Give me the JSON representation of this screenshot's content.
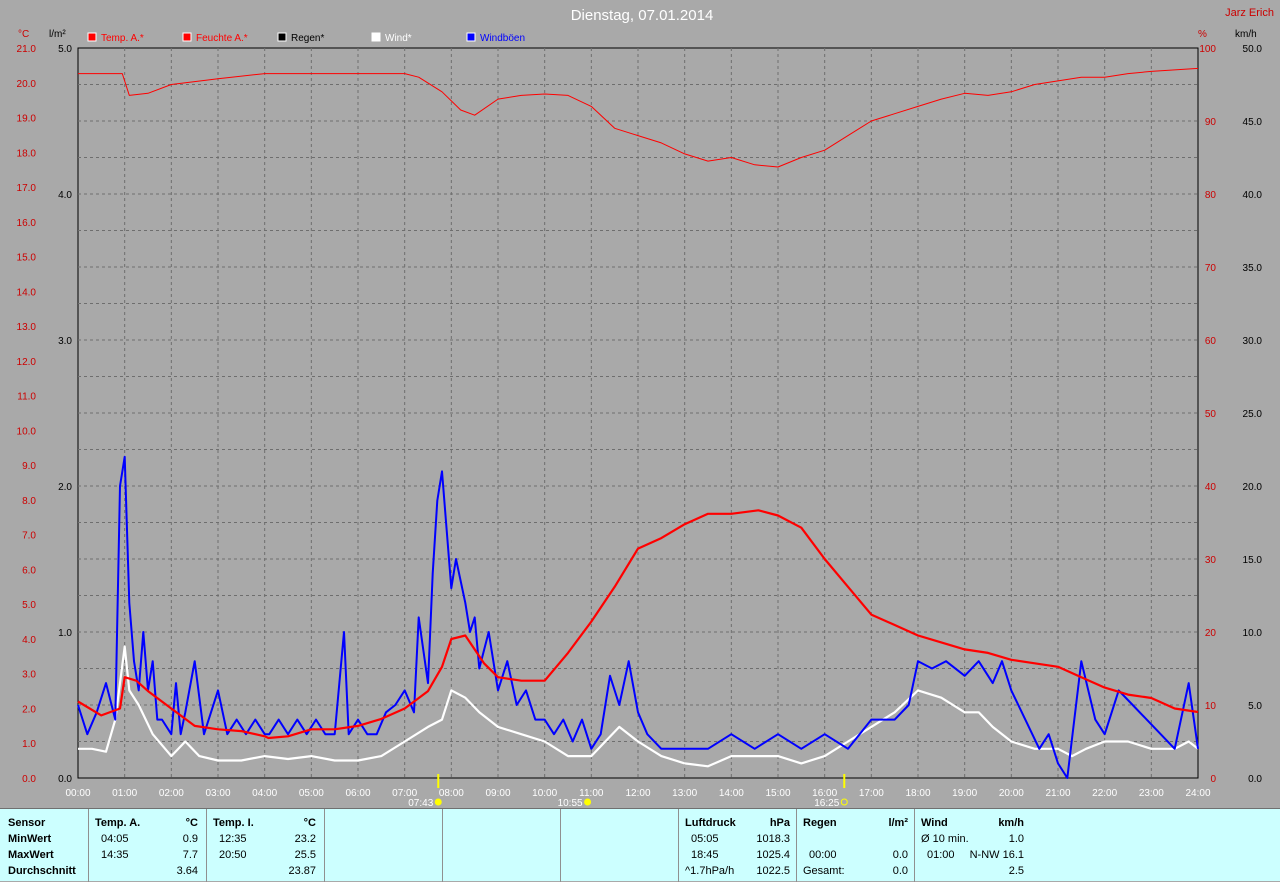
{
  "header": {
    "date": "Dienstag, 07.01.2014",
    "author": "Jarz Erich",
    "unit_temp": "°C",
    "unit_rain": "l/m²",
    "unit_pct": "%",
    "unit_wind": "km/h"
  },
  "colors": {
    "background": "#a9a9a9",
    "temp": "#ff0000",
    "humidity": "#ff0000",
    "rain": "#000000",
    "wind": "#ffffff",
    "gusts": "#0000ff",
    "axis_red": "#cc0000",
    "panel": "#ccffff",
    "sun_marker": "#ffff00"
  },
  "legend": [
    {
      "label": "Temp. A.*",
      "color": "#ff0000"
    },
    {
      "label": "Feuchte A.*",
      "color": "#ff0000"
    },
    {
      "label": "Regen*",
      "color": "#000000"
    },
    {
      "label": "Wind*",
      "color": "#ffffff"
    },
    {
      "label": "Windböen",
      "color": "#0000ff"
    }
  ],
  "chart_data": {
    "type": "line",
    "title": "Dienstag, 07.01.2014",
    "x_range_hours": [
      0,
      24
    ],
    "x_ticks": [
      "00:00",
      "01:00",
      "02:00",
      "03:00",
      "04:00",
      "05:00",
      "06:00",
      "07:00",
      "08:00",
      "09:00",
      "10:00",
      "11:00",
      "12:00",
      "13:00",
      "14:00",
      "15:00",
      "16:00",
      "17:00",
      "18:00",
      "19:00",
      "20:00",
      "21:00",
      "22:00",
      "23:00",
      "24:00"
    ],
    "axes": {
      "temp": {
        "range": [
          0,
          21
        ],
        "ticks": [
          "0.0",
          "1.0",
          "2.0",
          "3.0",
          "4.0",
          "5.0",
          "6.0",
          "7.0",
          "8.0",
          "9.0",
          "10.0",
          "11.0",
          "12.0",
          "13.0",
          "14.0",
          "15.0",
          "16.0",
          "17.0",
          "18.0",
          "19.0",
          "20.0",
          "21.0"
        ]
      },
      "rain": {
        "range": [
          0,
          5
        ],
        "ticks": [
          "0.0",
          "1.0",
          "2.0",
          "3.0",
          "4.0",
          "5.0"
        ]
      },
      "humidity": {
        "range": [
          0,
          100
        ],
        "ticks": [
          "0",
          "10",
          "20",
          "30",
          "40",
          "50",
          "60",
          "70",
          "80",
          "90",
          "100"
        ]
      },
      "wind": {
        "range": [
          0,
          50
        ],
        "ticks": [
          "0.0",
          "5.0",
          "10.0",
          "15.0",
          "20.0",
          "25.0",
          "30.0",
          "35.0",
          "40.0",
          "45.0",
          "50.0"
        ]
      }
    },
    "grid": true,
    "markers": [
      {
        "label": "07:43",
        "hour": 7.72,
        "kind": "sunrise"
      },
      {
        "label": "10:55",
        "hour": 10.92,
        "kind": "noon"
      },
      {
        "label": "16:25",
        "hour": 16.42,
        "kind": "sunset"
      }
    ],
    "series": [
      {
        "name": "Temp. A.*",
        "axis": "temp",
        "x": [
          0,
          0.5,
          0.9,
          1.0,
          1.25,
          1.5,
          2.0,
          2.5,
          3.0,
          3.5,
          4.0,
          4.08,
          4.5,
          5.0,
          5.5,
          6.0,
          6.5,
          7.0,
          7.5,
          7.8,
          8.0,
          8.3,
          8.7,
          9.0,
          9.5,
          10.0,
          10.5,
          11.0,
          11.5,
          12.0,
          12.5,
          13.0,
          13.5,
          14.0,
          14.58,
          15.0,
          15.5,
          16.0,
          16.5,
          17.0,
          17.5,
          18.0,
          18.5,
          19.0,
          19.5,
          20.0,
          20.5,
          21.0,
          21.5,
          22.0,
          22.5,
          23.0,
          23.5,
          24.0
        ],
        "y": [
          2.2,
          1.8,
          2.0,
          2.9,
          2.8,
          2.5,
          2.0,
          1.5,
          1.4,
          1.35,
          1.2,
          1.15,
          1.2,
          1.4,
          1.4,
          1.5,
          1.7,
          2.0,
          2.5,
          3.2,
          4.0,
          4.1,
          3.3,
          2.9,
          2.8,
          2.8,
          3.6,
          4.5,
          5.5,
          6.6,
          6.9,
          7.3,
          7.6,
          7.6,
          7.7,
          7.55,
          7.2,
          6.3,
          5.5,
          4.7,
          4.4,
          4.1,
          3.9,
          3.7,
          3.6,
          3.4,
          3.3,
          3.2,
          2.9,
          2.6,
          2.4,
          2.3,
          2.0,
          1.9
        ]
      },
      {
        "name": "Feuchte A.*",
        "axis": "humidity",
        "x": [
          0,
          0.5,
          0.95,
          1.1,
          1.5,
          2.0,
          3.0,
          4.0,
          5.0,
          6.0,
          7.0,
          7.3,
          7.8,
          8.2,
          8.5,
          9.0,
          9.5,
          10.0,
          10.5,
          11.0,
          11.5,
          12.0,
          12.5,
          13.0,
          13.5,
          14.0,
          14.5,
          15.0,
          15.5,
          16.0,
          16.5,
          17.0,
          17.5,
          18.0,
          18.5,
          19.0,
          19.5,
          20.0,
          20.5,
          21.0,
          21.5,
          22.0,
          22.5,
          23.0,
          23.5,
          24.0
        ],
        "y": [
          96.5,
          96.5,
          96.5,
          93.5,
          93.8,
          95.0,
          95.8,
          96.5,
          96.5,
          96.5,
          96.5,
          96.0,
          94.0,
          91.5,
          90.8,
          93.0,
          93.5,
          93.7,
          93.5,
          92.0,
          89.0,
          88.0,
          87.0,
          85.5,
          84.5,
          85.0,
          84.0,
          83.7,
          85.0,
          86.0,
          88.0,
          90.0,
          91.0,
          92.0,
          93.0,
          93.8,
          93.5,
          94.0,
          95.0,
          95.5,
          96.0,
          96.0,
          96.5,
          96.8,
          97.0,
          97.2
        ]
      },
      {
        "name": "Wind*",
        "axis": "wind",
        "x": [
          0,
          0.3,
          0.6,
          0.8,
          1.0,
          1.1,
          1.3,
          1.6,
          2.0,
          2.3,
          2.6,
          3.0,
          3.5,
          4.0,
          4.5,
          5.0,
          5.5,
          6.0,
          6.5,
          7.0,
          7.5,
          7.8,
          8.0,
          8.3,
          8.6,
          9.0,
          9.5,
          10.0,
          10.5,
          11.0,
          11.3,
          11.6,
          12.0,
          12.5,
          13.0,
          13.5,
          14.0,
          14.5,
          15.0,
          15.5,
          16.0,
          16.5,
          17.0,
          17.5,
          18.0,
          18.5,
          19.0,
          19.3,
          19.6,
          20.0,
          20.5,
          21.0,
          21.3,
          21.6,
          22.0,
          22.5,
          23.0,
          23.5,
          23.8,
          24.0
        ],
        "y": [
          2.0,
          2.0,
          1.8,
          4.0,
          9.0,
          6.0,
          5.0,
          3.0,
          1.5,
          2.5,
          1.5,
          1.2,
          1.2,
          1.5,
          1.3,
          1.5,
          1.2,
          1.2,
          1.5,
          2.5,
          3.5,
          4.0,
          6.0,
          5.5,
          4.5,
          3.5,
          3.0,
          2.5,
          1.5,
          1.5,
          2.5,
          3.5,
          2.5,
          1.5,
          1.0,
          0.8,
          1.5,
          1.5,
          1.5,
          1.0,
          1.5,
          2.5,
          3.5,
          4.5,
          6.0,
          5.5,
          4.5,
          4.5,
          3.5,
          2.5,
          2.0,
          2.0,
          1.5,
          2.0,
          2.5,
          2.5,
          2.0,
          2.0,
          2.5,
          2.0
        ]
      },
      {
        "name": "Windböen",
        "axis": "wind",
        "x": [
          0,
          0.2,
          0.4,
          0.6,
          0.8,
          0.9,
          1.0,
          1.1,
          1.2,
          1.3,
          1.4,
          1.5,
          1.6,
          1.7,
          1.8,
          2.0,
          2.1,
          2.2,
          2.3,
          2.5,
          2.7,
          3.0,
          3.2,
          3.4,
          3.6,
          3.8,
          4.0,
          4.1,
          4.3,
          4.5,
          4.7,
          4.9,
          5.1,
          5.3,
          5.5,
          5.7,
          5.8,
          6.0,
          6.2,
          6.4,
          6.6,
          6.8,
          7.0,
          7.2,
          7.3,
          7.5,
          7.6,
          7.7,
          7.8,
          8.0,
          8.1,
          8.3,
          8.4,
          8.5,
          8.6,
          8.8,
          9.0,
          9.2,
          9.4,
          9.6,
          9.8,
          10.0,
          10.2,
          10.4,
          10.6,
          10.8,
          11.0,
          11.2,
          11.4,
          11.6,
          11.8,
          12.0,
          12.2,
          12.5,
          13.0,
          13.5,
          14.0,
          14.5,
          15.0,
          15.5,
          16.0,
          16.5,
          17.0,
          17.2,
          17.5,
          17.8,
          18.0,
          18.3,
          18.6,
          19.0,
          19.3,
          19.6,
          19.8,
          20.0,
          20.3,
          20.6,
          20.8,
          21.0,
          21.2,
          21.5,
          21.8,
          22.0,
          22.3,
          22.6,
          22.9,
          23.2,
          23.5,
          23.8,
          24.0
        ],
        "y": [
          5.0,
          3.0,
          4.5,
          6.5,
          4.0,
          20.0,
          22.0,
          12.0,
          8.0,
          6.0,
          10.0,
          6.0,
          8.0,
          4.0,
          4.0,
          3.0,
          6.5,
          3.0,
          4.5,
          8.0,
          3.0,
          6.0,
          3.0,
          4.0,
          3.0,
          4.0,
          3.0,
          3.0,
          4.0,
          3.0,
          4.0,
          3.0,
          4.0,
          3.0,
          3.0,
          10.0,
          3.0,
          4.0,
          3.0,
          3.0,
          4.5,
          5.0,
          6.0,
          4.5,
          11.0,
          6.5,
          14.0,
          19.0,
          21.0,
          13.0,
          15.0,
          12.0,
          10.0,
          11.0,
          7.5,
          10.0,
          6.0,
          8.0,
          5.0,
          6.0,
          4.0,
          4.0,
          3.0,
          4.0,
          2.5,
          4.0,
          2.0,
          3.0,
          7.0,
          5.0,
          8.0,
          4.5,
          3.0,
          2.0,
          2.0,
          2.0,
          3.0,
          2.0,
          3.0,
          2.0,
          3.0,
          2.0,
          4.0,
          4.0,
          4.0,
          5.0,
          8.0,
          7.5,
          8.0,
          7.0,
          8.0,
          6.5,
          8.0,
          6.0,
          4.0,
          2.0,
          3.0,
          1.0,
          0.0,
          8.0,
          4.0,
          3.0,
          6.0,
          5.0,
          4.0,
          3.0,
          2.0,
          6.5,
          2.0
        ]
      }
    ]
  },
  "table": {
    "sensor_labels": [
      "Sensor",
      "MinWert",
      "MaxWert",
      "Durchschnitt"
    ],
    "temp_a": {
      "header": "Temp. A.",
      "unit": "°C",
      "min_time": "04:05",
      "min": "0.9",
      "max_time": "14:35",
      "max": "7.7",
      "avg": "3.64"
    },
    "temp_i": {
      "header": "Temp. I.",
      "unit": "°C",
      "min_time": "12:35",
      "min": "23.2",
      "max_time": "20:50",
      "max": "25.5",
      "avg": "23.87"
    },
    "pressure": {
      "header": "Luftdruck",
      "unit": "hPa",
      "min_time": "05:05",
      "min": "1018.3",
      "max_time": "18:45",
      "max": "1025.4",
      "trend": "^1.7hPa/h",
      "current": "1022.5"
    },
    "rain": {
      "header": "Regen",
      "unit": "l/m²",
      "time": "00:00",
      "value": "0.0",
      "total_label": "Gesamt:",
      "total": "0.0"
    },
    "wind": {
      "header": "Wind",
      "unit": "km/h",
      "avg_label": "Ø 10 min.",
      "avg": "1.0",
      "max_time": "01:00",
      "max_dir": "N-NW 16.1",
      "current": "2.5"
    }
  }
}
